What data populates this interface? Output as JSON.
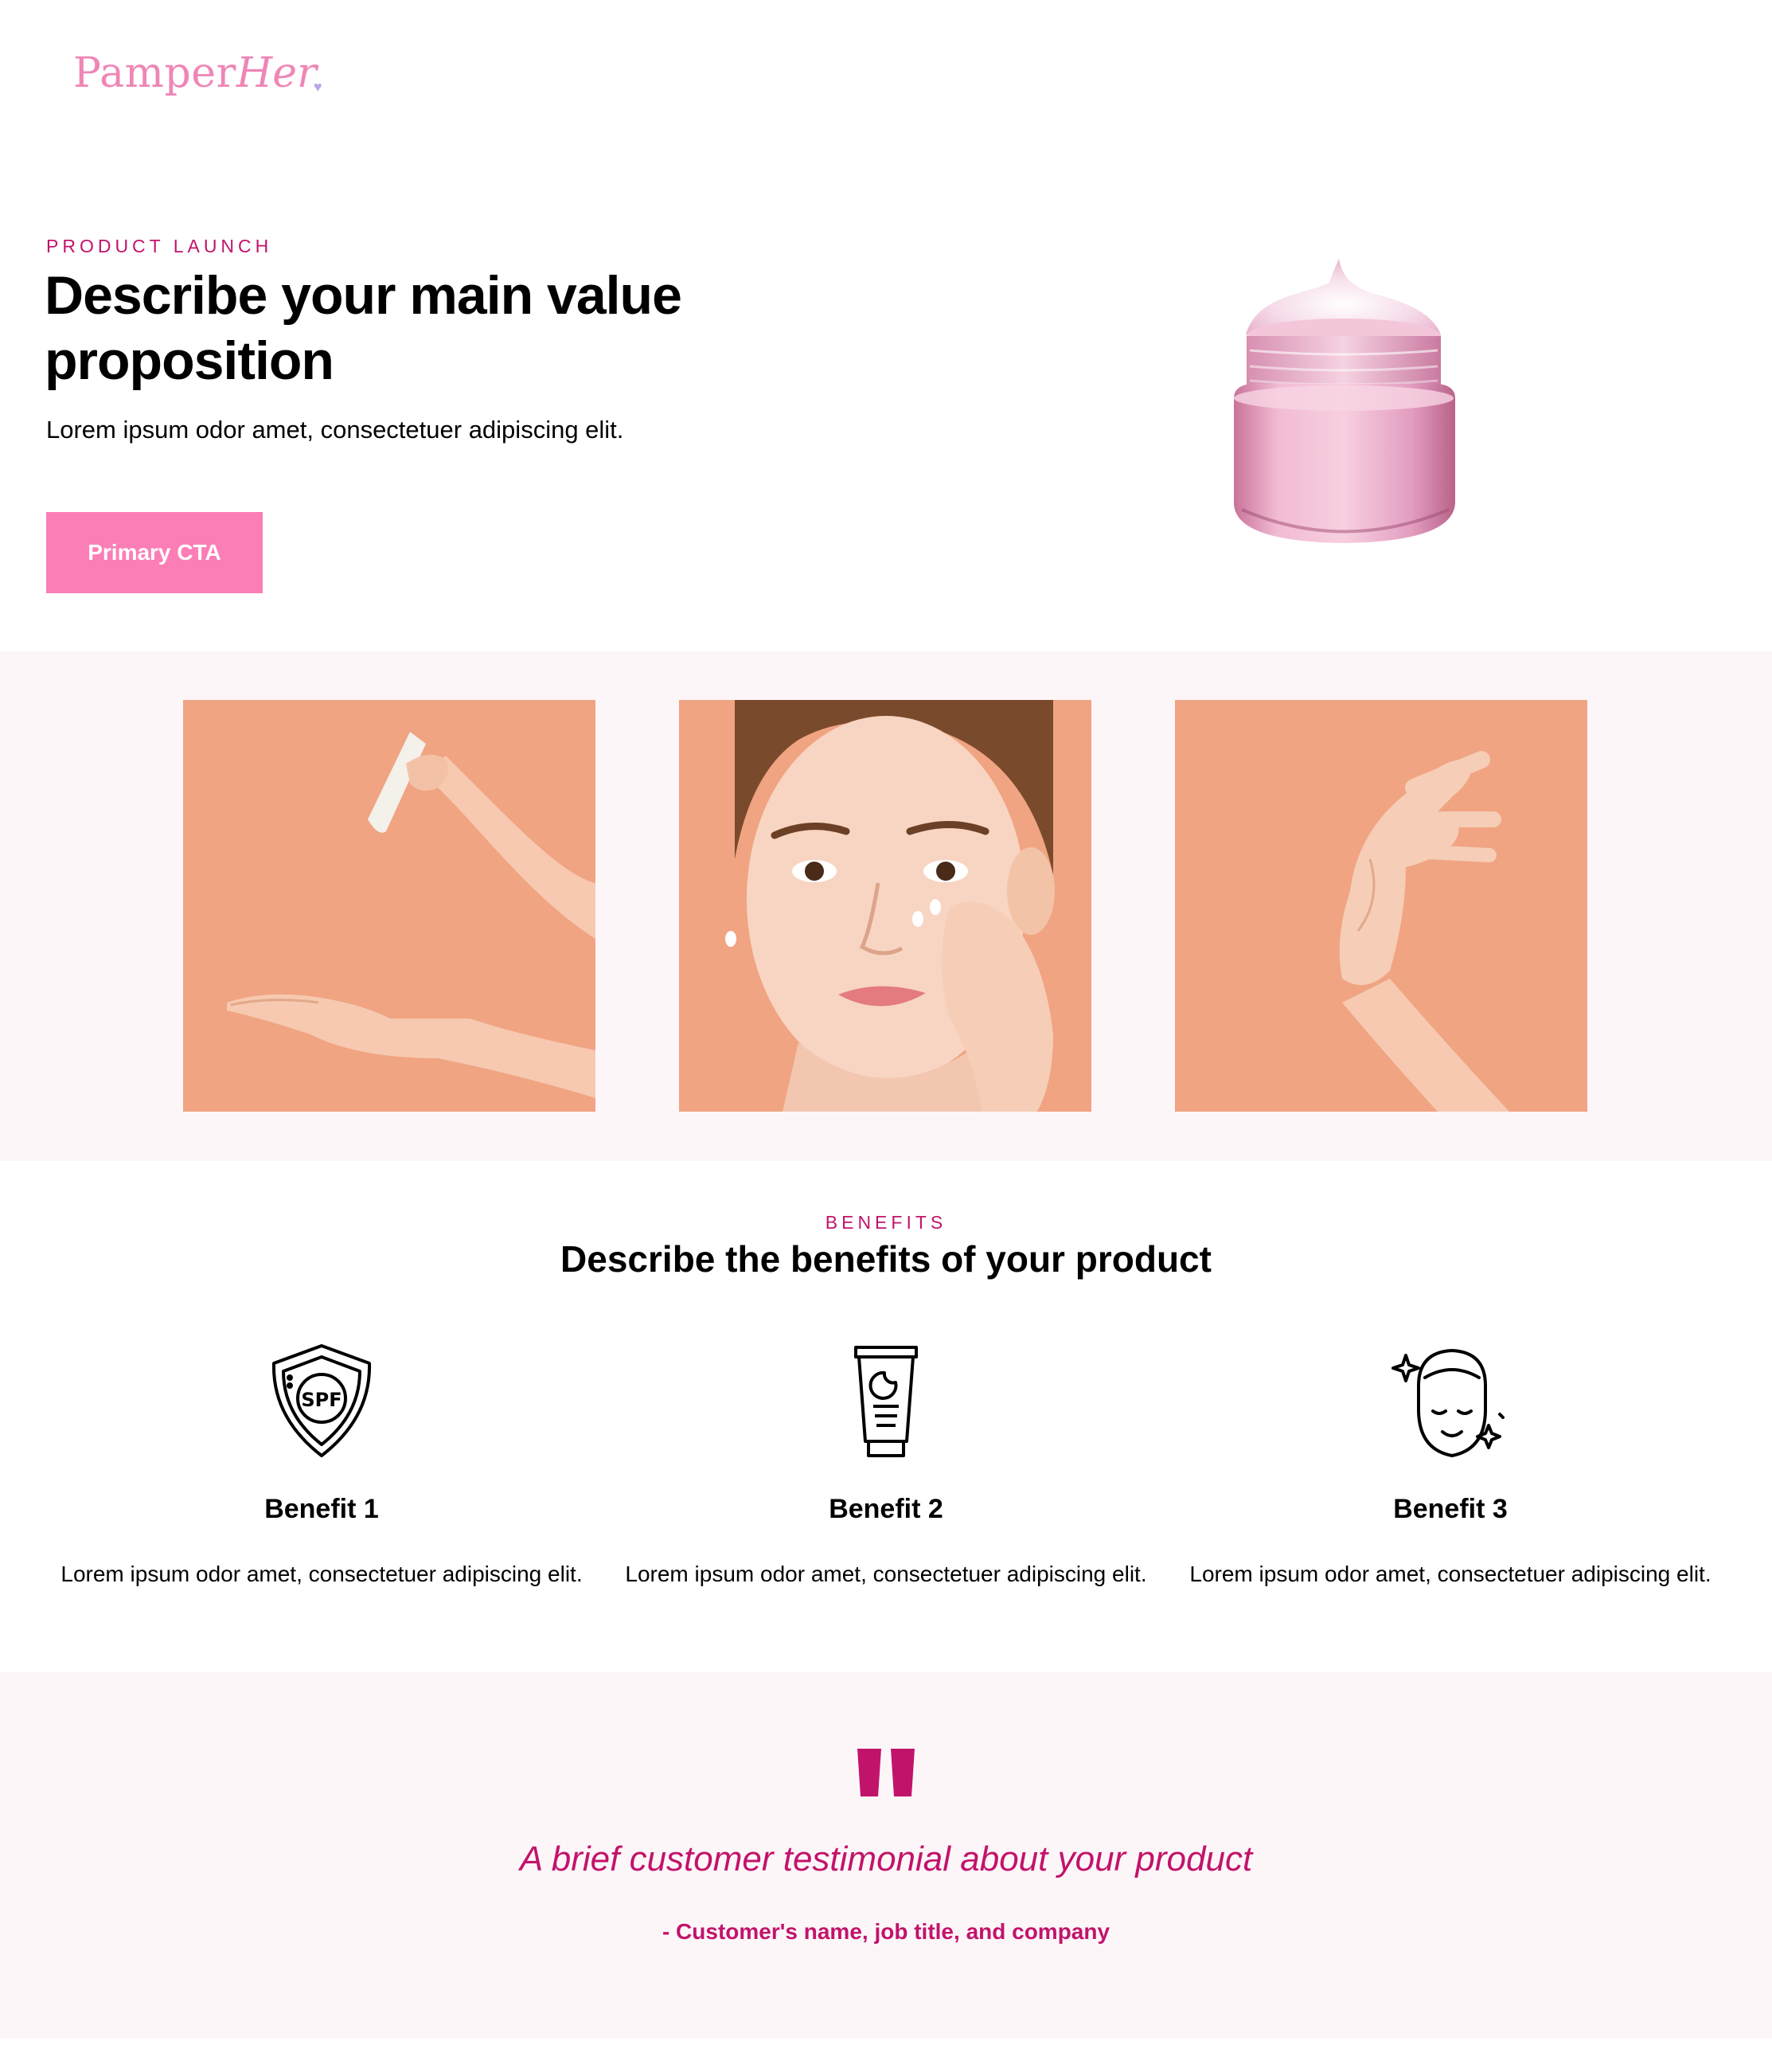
{
  "brand": {
    "name_part1": "Pamper",
    "name_part2": "Her",
    "heart": "♥"
  },
  "hero": {
    "eyebrow": "PRODUCT LAUNCH",
    "title": "Describe your main value proposition",
    "subtitle": "Lorem ipsum odor amet, consectetuer adipiscing elit.",
    "cta_label": "Primary CTA"
  },
  "gallery": {
    "photos": [
      "hands-applying-cream-photo",
      "woman-applying-cream-photo",
      "hands-rubbing-cream-photo"
    ]
  },
  "benefits": {
    "eyebrow": "BENEFITS",
    "title": "Describe the benefits of your product",
    "items": [
      {
        "icon": "spf-shield-icon",
        "title": "Benefit 1",
        "text": "Lorem ipsum odor amet, consectetuer adipiscing elit."
      },
      {
        "icon": "night-cream-tube-icon",
        "title": "Benefit 2",
        "text": "Lorem ipsum odor amet, consectetuer adipiscing elit."
      },
      {
        "icon": "glowing-face-icon",
        "title": "Benefit 3",
        "text": "Lorem ipsum odor amet, consectetuer adipiscing elit."
      }
    ]
  },
  "testimonial": {
    "quote": "A brief customer testimonial about your product",
    "author": "- Customer's name, job title, and company"
  },
  "colors": {
    "accent": "#c2136b",
    "cta": "#fb7eb7",
    "logo": "#ef86b6",
    "band": "#fdf6f9",
    "photo_bg": "#f0a482"
  }
}
